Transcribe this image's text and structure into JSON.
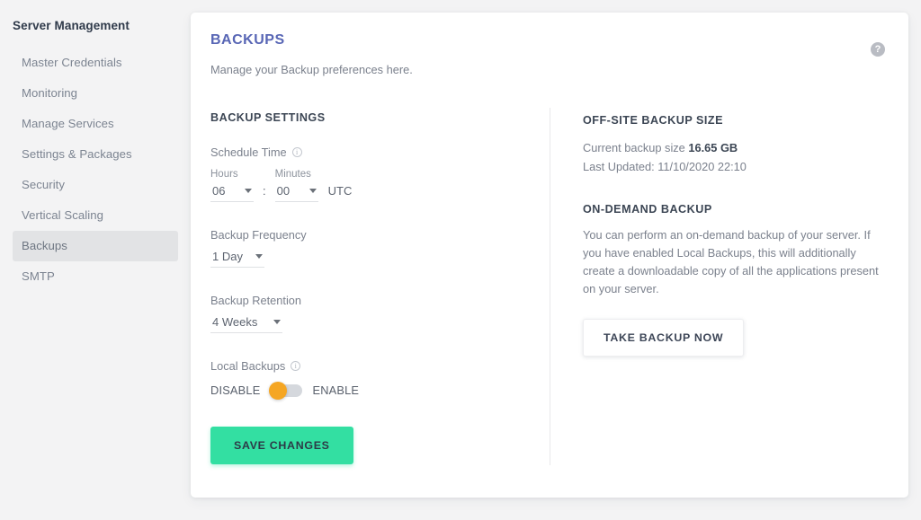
{
  "sidebar": {
    "title": "Server Management",
    "items": [
      {
        "label": "Master Credentials",
        "active": false
      },
      {
        "label": "Monitoring",
        "active": false
      },
      {
        "label": "Manage Services",
        "active": false
      },
      {
        "label": "Settings & Packages",
        "active": false
      },
      {
        "label": "Security",
        "active": false
      },
      {
        "label": "Vertical Scaling",
        "active": false
      },
      {
        "label": "Backups",
        "active": true
      },
      {
        "label": "SMTP",
        "active": false
      }
    ]
  },
  "card": {
    "title": "BACKUPS",
    "subtitle": "Manage your Backup preferences here.",
    "help_icon": "help-icon",
    "help_glyph": "?"
  },
  "backup_settings": {
    "heading": "BACKUP SETTINGS",
    "schedule_time": {
      "label": "Schedule Time",
      "info_glyph": "i",
      "hours_caption": "Hours",
      "minutes_caption": "Minutes",
      "hours_value": "06",
      "minutes_value": "00",
      "separator": ":",
      "timezone": "UTC"
    },
    "frequency": {
      "label": "Backup Frequency",
      "value": "1 Day"
    },
    "retention": {
      "label": "Backup Retention",
      "value": "4 Weeks"
    },
    "local_backups": {
      "label": "Local Backups",
      "info_glyph": "i",
      "off_label": "DISABLE",
      "on_label": "ENABLE",
      "state": "disabled"
    },
    "save_label": "SAVE CHANGES"
  },
  "offsite": {
    "heading": "OFF-SITE BACKUP SIZE",
    "current_label": "Current backup size",
    "current_value": "16.65 GB",
    "last_updated": "Last Updated: 11/10/2020 22:10"
  },
  "ondemand": {
    "heading": "ON-DEMAND BACKUP",
    "description": "You can perform an on-demand backup of your server. If you have enabled Local Backups, this will additionally create a downloadable copy of all the applications present on your server.",
    "button_label": "TAKE BACKUP NOW"
  },
  "colors": {
    "accent_title": "#5866b5",
    "save_green": "#33dfa2",
    "toggle_knob": "#f5a623",
    "page_bg": "#f3f3f4",
    "card_bg": "#ffffff"
  }
}
